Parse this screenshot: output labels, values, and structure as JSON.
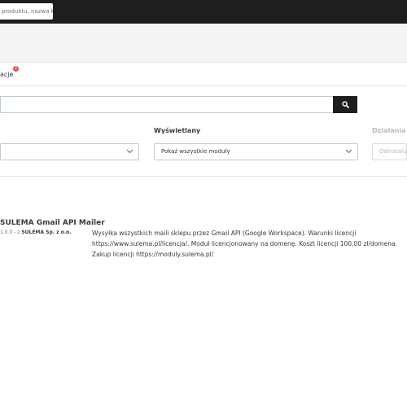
{
  "topbar": {
    "search_placeholder": "produktu, nazwa k"
  },
  "tabs": {
    "active_label": "acje",
    "badge_count": "2"
  },
  "module_search": {
    "value": "",
    "button_icon": "search-icon"
  },
  "filters": {
    "category": {
      "label": "",
      "value": ""
    },
    "displayed": {
      "label": "Wyświetlany",
      "value": "Pokaż wszystkie moduły"
    },
    "actions": {
      "label": "Działania m",
      "value": "Odinstalu"
    }
  },
  "module": {
    "name": "SULEMA Gmail API Mailer",
    "version_prefix": "1.0.0 - z ",
    "author": "SULEMA Sp. z o.o.",
    "description": "Wysyłka wszystkich maili sklepu przez Gmail API (Google Workspace). Warunki licencji https://www.sulema.pl/licencja/. Moduł licencjonowany na domenę. Koszt licencji 100,00 zł/domena. Zakup licencji https://moduly.sulema.pl/"
  },
  "colors": {
    "topbar": "#1e1e1e",
    "badge": "#e84e4e",
    "search_button": "#1e1e1e"
  }
}
